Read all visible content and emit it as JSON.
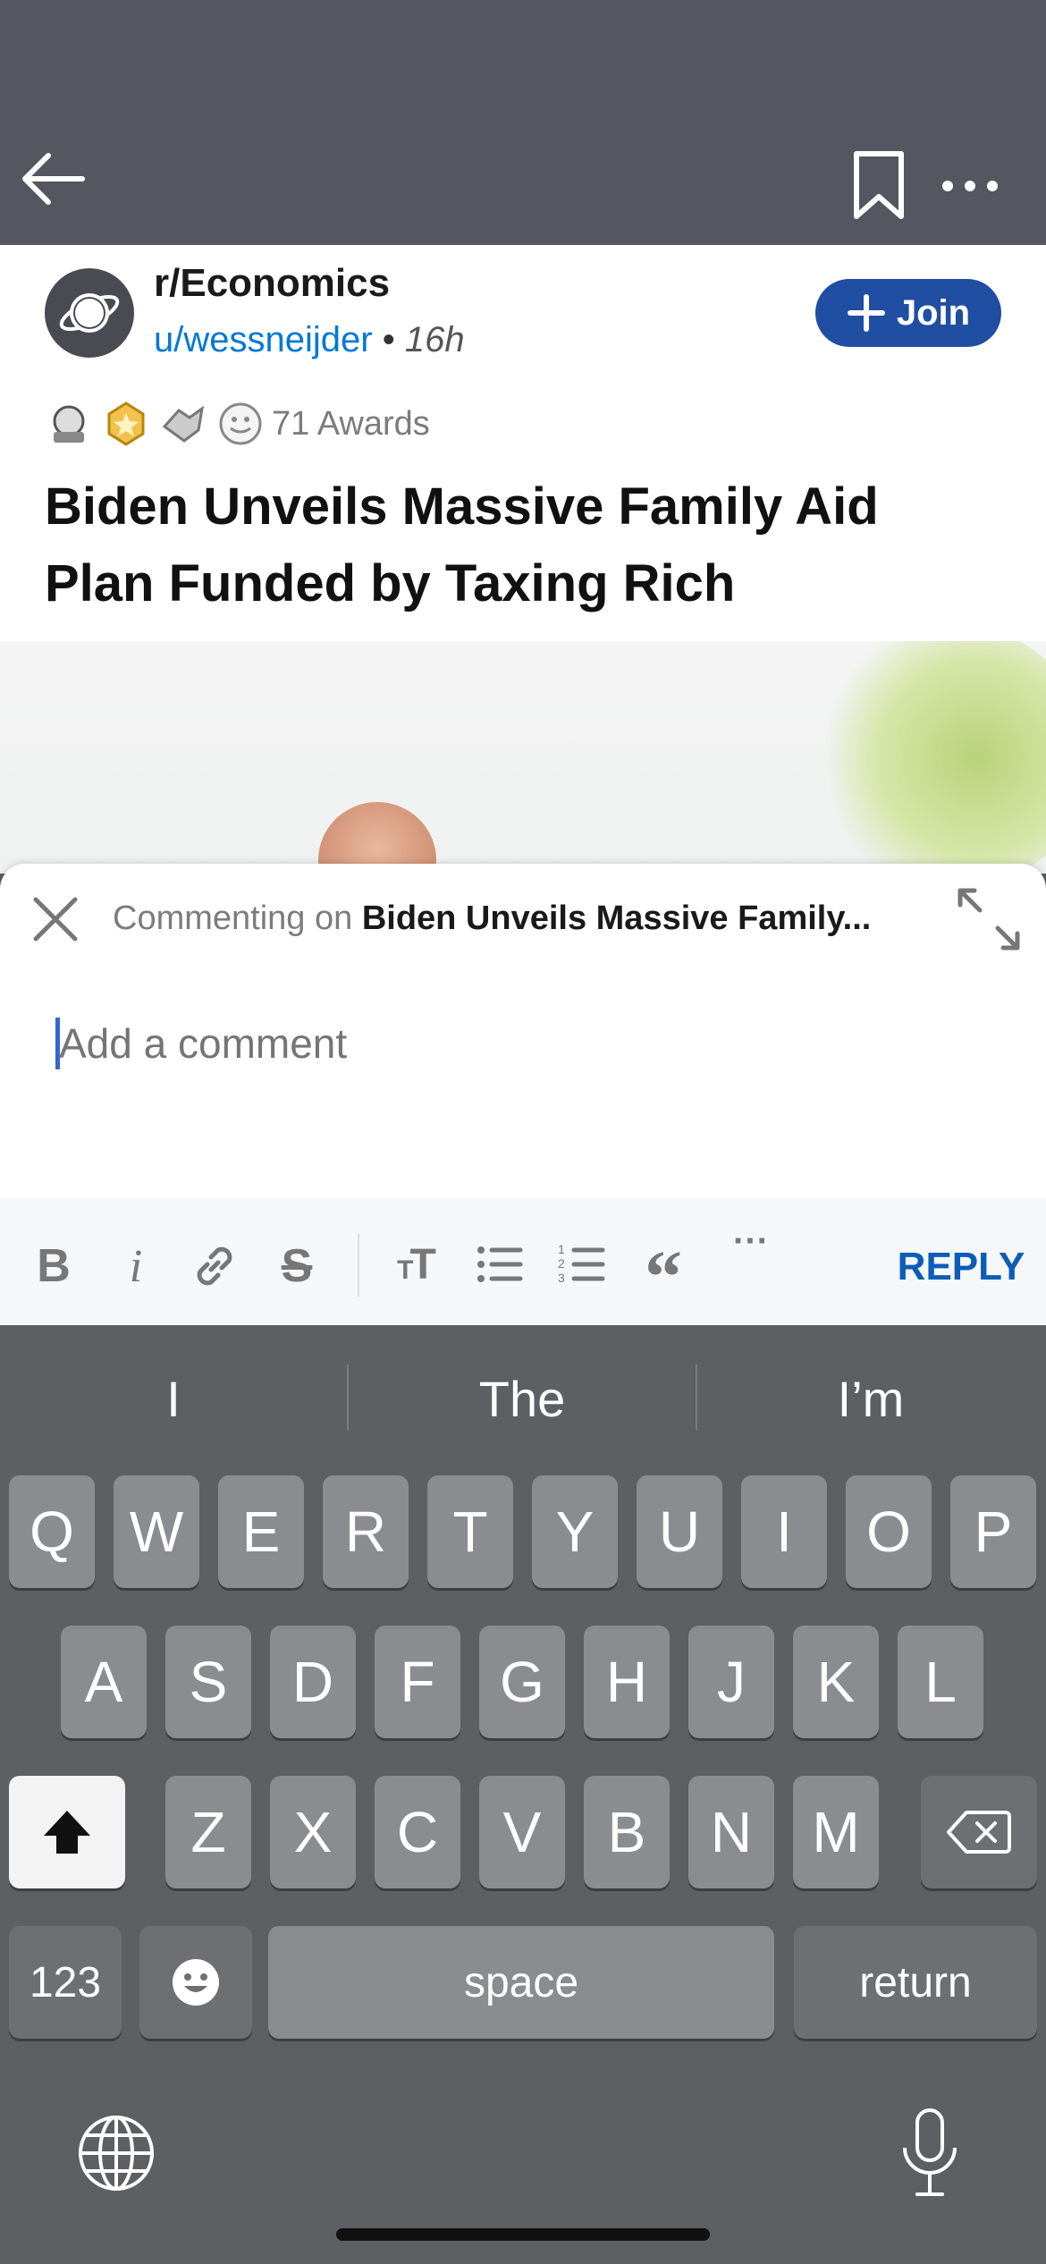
{
  "nav": {
    "back_icon": "arrow-left-icon",
    "bookmark_icon": "bookmark-icon",
    "more_icon": "ellipsis-icon"
  },
  "post": {
    "subreddit": "r/Economics",
    "author": "u/wessneijder",
    "separator": "•",
    "age": "16h",
    "join_label": "Join",
    "awards_label": "71 Awards",
    "title": "Biden Unveils Massive Family Aid Plan Funded by Taxing Rich"
  },
  "composer": {
    "commenting_prefix": "Commenting on",
    "commenting_target": "Biden Unveils Massive Family...",
    "placeholder": "Add a comment",
    "reply_label": "REPLY",
    "tools": [
      "bold-icon",
      "italic-icon",
      "link-icon",
      "strikethrough-icon",
      "text-size-icon",
      "bulleted-list-icon",
      "numbered-list-icon",
      "quote-icon",
      "more-icon"
    ]
  },
  "keyboard": {
    "suggestions": [
      "I",
      "The",
      "I’m"
    ],
    "row1": [
      "Q",
      "W",
      "E",
      "R",
      "T",
      "Y",
      "U",
      "I",
      "O",
      "P"
    ],
    "row2": [
      "A",
      "S",
      "D",
      "F",
      "G",
      "H",
      "J",
      "K",
      "L"
    ],
    "row3": [
      "Z",
      "X",
      "C",
      "V",
      "B",
      "N",
      "M"
    ],
    "numbers_label": "123",
    "space_label": "space",
    "return_label": "return"
  },
  "colors": {
    "accent": "#1f4ea3",
    "link": "#0079d3",
    "reply": "#0c5db8"
  }
}
